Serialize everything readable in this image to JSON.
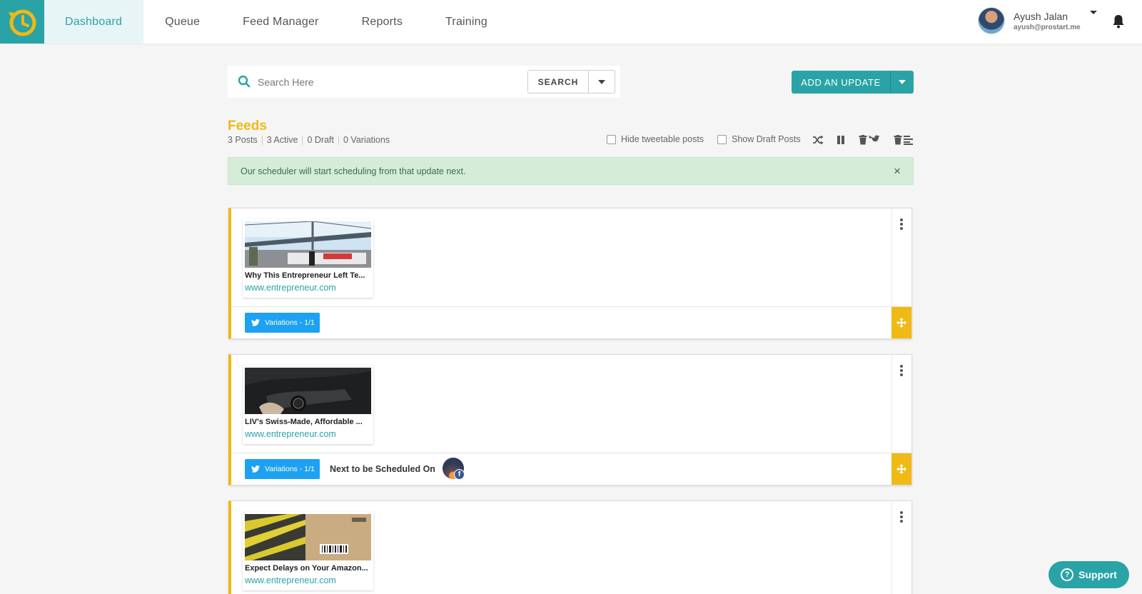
{
  "nav": {
    "items": [
      {
        "label": "Dashboard",
        "active": true
      },
      {
        "label": "Queue"
      },
      {
        "label": "Feed Manager"
      },
      {
        "label": "Reports"
      },
      {
        "label": "Training"
      }
    ]
  },
  "user": {
    "name": "Ayush Jalan",
    "email": "ayush@prostart.me"
  },
  "search": {
    "placeholder": "Search Here",
    "button_label": "SEARCH"
  },
  "add_update": {
    "label": "ADD AN UPDATE"
  },
  "feeds": {
    "title": "Feeds",
    "stats": [
      "3 Posts",
      "3 Active",
      "0 Draft",
      "0 Variations"
    ],
    "hide_tweetable_label": "Hide tweetable posts",
    "show_drafts_label": "Show Draft Posts"
  },
  "alert": {
    "message": "Our scheduler will start scheduling from that update next.",
    "close": "×"
  },
  "posts": [
    {
      "title": "Why This Entrepreneur Left Te...",
      "link": "www.entrepreneur.com",
      "variations": "Variations - 1/1",
      "next_label": ""
    },
    {
      "title": "LIV's Swiss-Made, Affordable ...",
      "link": "www.entrepreneur.com",
      "variations": "Variations - 1/1",
      "next_label": "Next to be Scheduled On"
    },
    {
      "title": "Expect Delays on Your Amazon...",
      "link": "www.entrepreneur.com",
      "variations": "",
      "next_label": ""
    }
  ],
  "support": {
    "label": "Support",
    "icon": "?"
  },
  "colors": {
    "brand": "#2aa3a7",
    "accent": "#f0b913",
    "twitter": "#1da1f2"
  }
}
